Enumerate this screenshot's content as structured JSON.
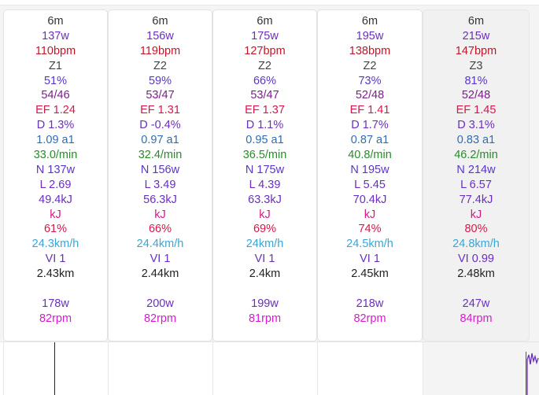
{
  "colors": {
    "duration": "#333333",
    "power": "#6a2fc0",
    "hr": "#c4162a",
    "zone": "#444444",
    "percent": "#5a35c8",
    "ratio": "#7a1f8a",
    "ef": "#d6184a",
    "drift": "#6a2fc0",
    "alpha": "#2f6db0",
    "cadence_rate": "#2a8a2a",
    "np": "#5a35c8",
    "load": "#6a2fc0",
    "work": "#6a2fc0",
    "kj": "#d6188a",
    "intensity": "#d6184a",
    "speed": "#3aa5d6",
    "vi": "#6a2fc0",
    "distance": "#222222",
    "avg_power": "#6a2fc0",
    "rpm": "#d81bd0"
  },
  "intervals": [
    {
      "duration": "6m",
      "power": "137w",
      "hr": "110bpm",
      "zone": "Z1",
      "percent": "51%",
      "ratio": "54/46",
      "ef": "EF 1.24",
      "drift": "D 1.3%",
      "alpha": "1.09 a1",
      "cadence_rate": "33.0/min",
      "np": "N 137w",
      "load": "L 2.69",
      "work": "49.4kJ",
      "kj": "kJ",
      "intensity": "61%",
      "speed": "24.3km/h",
      "vi": "VI 1",
      "distance": "2.43km",
      "avg_power": "178w",
      "rpm": "82rpm"
    },
    {
      "duration": "6m",
      "power": "156w",
      "hr": "119bpm",
      "zone": "Z2",
      "percent": "59%",
      "ratio": "53/47",
      "ef": "EF 1.31",
      "drift": "D -0.4%",
      "alpha": "0.97 a1",
      "cadence_rate": "32.4/min",
      "np": "N 156w",
      "load": "L 3.49",
      "work": "56.3kJ",
      "kj": "kJ",
      "intensity": "66%",
      "speed": "24.4km/h",
      "vi": "VI 1",
      "distance": "2.44km",
      "avg_power": "200w",
      "rpm": "82rpm"
    },
    {
      "duration": "6m",
      "power": "175w",
      "hr": "127bpm",
      "zone": "Z2",
      "percent": "66%",
      "ratio": "53/47",
      "ef": "EF 1.37",
      "drift": "D 1.1%",
      "alpha": "0.95 a1",
      "cadence_rate": "36.5/min",
      "np": "N 175w",
      "load": "L 4.39",
      "work": "63.3kJ",
      "kj": "kJ",
      "intensity": "69%",
      "speed": "24km/h",
      "vi": "VI 1",
      "distance": "2.4km",
      "avg_power": "199w",
      "rpm": "81rpm"
    },
    {
      "duration": "6m",
      "power": "195w",
      "hr": "138bpm",
      "zone": "Z2",
      "percent": "73%",
      "ratio": "52/48",
      "ef": "EF 1.41",
      "drift": "D 1.7%",
      "alpha": "0.87 a1",
      "cadence_rate": "40.8/min",
      "np": "N 195w",
      "load": "L 5.45",
      "work": "70.4kJ",
      "kj": "kJ",
      "intensity": "74%",
      "speed": "24.5km/h",
      "vi": "VI 1",
      "distance": "2.45km",
      "avg_power": "218w",
      "rpm": "82rpm"
    },
    {
      "duration": "6m",
      "power": "215w",
      "hr": "147bpm",
      "zone": "Z3",
      "percent": "81%",
      "ratio": "52/48",
      "ef": "EF 1.45",
      "drift": "D 3.1%",
      "alpha": "0.83 a1",
      "cadence_rate": "46.2/min",
      "np": "N 214w",
      "load": "L 6.57",
      "work": "77.4kJ",
      "kj": "kJ",
      "intensity": "80%",
      "speed": "24.8km/h",
      "vi": "VI 0.99",
      "distance": "2.48km",
      "avg_power": "247w",
      "rpm": "84rpm"
    }
  ]
}
